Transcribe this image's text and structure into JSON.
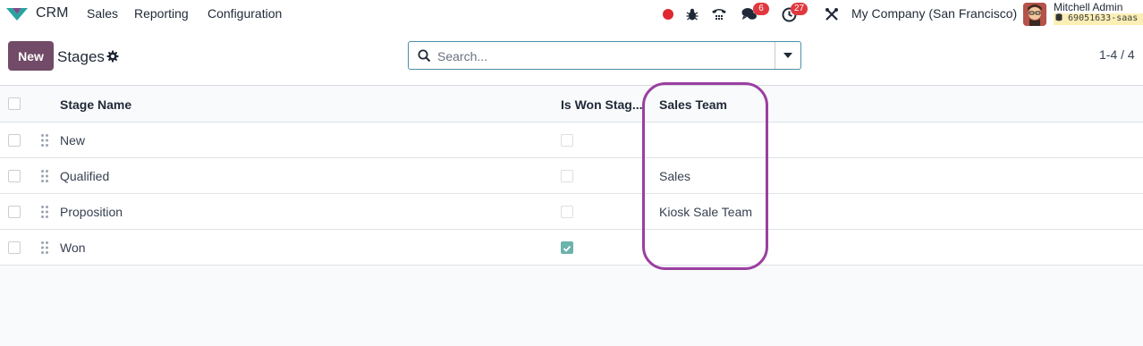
{
  "navbar": {
    "app_name": "CRM",
    "menus": [
      "Sales",
      "Reporting",
      "Configuration"
    ],
    "messages_count": "6",
    "activities_count": "27",
    "company": "My Company (San Francisco)",
    "user_name": "Mitchell Admin",
    "database": "69051633-saas"
  },
  "control": {
    "new_label": "New",
    "title": "Stages",
    "search_placeholder": "Search...",
    "pager": "1-4 / 4"
  },
  "table": {
    "columns": [
      "Stage Name",
      "Is Won Stag...",
      "Sales Team"
    ],
    "rows": [
      {
        "name": "New",
        "is_won": false,
        "team": ""
      },
      {
        "name": "Qualified",
        "is_won": false,
        "team": "Sales"
      },
      {
        "name": "Proposition",
        "is_won": false,
        "team": "Kiosk Sale Team"
      },
      {
        "name": "Won",
        "is_won": true,
        "team": ""
      }
    ]
  },
  "colors": {
    "brand": "#714b67",
    "highlight": "#9b3fa0",
    "badge": "#e0383e",
    "checked": "#6cb2ad"
  }
}
